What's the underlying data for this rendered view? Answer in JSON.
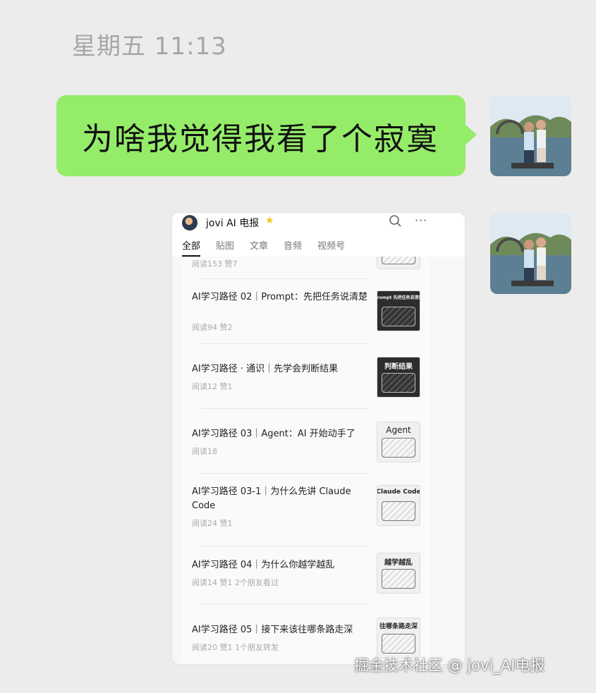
{
  "chat": {
    "timestamp": "星期五 11:13",
    "message": "为啥我觉得我看了个寂寞"
  },
  "shared_card": {
    "account_name": "jovi AI 电报",
    "tabs": [
      {
        "label": "全部",
        "active": true
      },
      {
        "label": "贴图",
        "active": false
      },
      {
        "label": "文章",
        "active": false
      },
      {
        "label": "音频",
        "active": false
      },
      {
        "label": "视频号",
        "active": false
      }
    ],
    "partial_row_meta": "阅读153  赞7",
    "articles": [
      {
        "title": "AI学习路径 02｜Prompt：先把任务说清楚",
        "meta": "阅读94  赞2",
        "thumb_text": "Prompt 先把任务说清楚"
      },
      {
        "title": "AI学习路径 · 通识｜先学会判断结果",
        "meta": "阅读12  赞1",
        "thumb_text": "判断结果"
      },
      {
        "title": "AI学习路径 03｜Agent：AI 开始动手了",
        "meta": "阅读18",
        "thumb_text": "Agent"
      },
      {
        "title": "AI学习路径 03-1｜为什么先讲 Claude Code",
        "meta": "阅读24  赞1",
        "thumb_text": "Claude Code"
      },
      {
        "title": "AI学习路径 04｜为什么你越学越乱",
        "meta": "阅读14  赞1  2个朋友看过",
        "thumb_text": "越学越乱"
      },
      {
        "title": "AI学习路径 05｜接下来该往哪条路走深",
        "meta": "阅读20  赞1  1个朋友转发",
        "thumb_text": "往哪条路走深"
      }
    ]
  },
  "watermark": "掘金技术社区 @ jovi_AI电报",
  "colors": {
    "background": "#ececec",
    "bubble": "#95ec69",
    "star": "#f5c518"
  }
}
